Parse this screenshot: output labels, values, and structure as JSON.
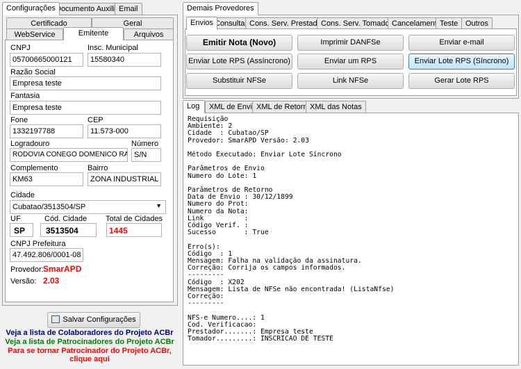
{
  "left": {
    "top_tabs": [
      "Configurações",
      "Documento Auxiliar",
      "Email"
    ],
    "row1_tabs": [
      "Certificado",
      "Geral"
    ],
    "row2_tabs": [
      "WebService",
      "Emitente",
      "Arquivos"
    ],
    "emitente": {
      "cnpj_label": "CNPJ",
      "cnpj": "05700665000121",
      "im_label": "Insc. Municipal",
      "im": "15580340",
      "razao_label": "Razão Social",
      "razao": "Empresa teste",
      "fantasia_label": "Fantasia",
      "fantasia": "Empresa teste",
      "fone_label": "Fone",
      "fone": "1332197788",
      "cep_label": "CEP",
      "cep": "11.573-000",
      "logradouro_label": "Logradouro",
      "logradouro": "RODOVIA CONEGO DOMENICO RANGO",
      "numero_label": "Número",
      "numero": "S/N",
      "complemento_label": "Complemento",
      "complemento": "KM63",
      "bairro_label": "Bairro",
      "bairro": "ZONA INDUSTRIAL",
      "cidade_label": "Cidade",
      "cidade": "Cubatao/3513504/SP",
      "uf_label": "UF",
      "uf": "SP",
      "cod_cidade_label": "Cód. Cidade",
      "cod_cidade": "3513504",
      "total_cidades_label": "Total de Cidades",
      "total_cidades": "1445",
      "cnpj_pref_label": "CNPJ Prefeitura",
      "cnpj_pref": "47.492.806/0001-08",
      "provedor_label": "Provedor:",
      "provedor": "SmarAPD",
      "versao_label": "Versão:",
      "versao": "2.03"
    },
    "save_button": "Salvar Configurações",
    "link_colaboradores": "Veja a lista de Colaboradores do Projeto ACBr",
    "link_patrocinadores": "Veja a lista de Patrocinadores do Projeto ACBr",
    "link_patrocinador_1": "Para se tornar Patrocinador do Projeto ACBr,",
    "link_patrocinador_2": "clique aqui"
  },
  "right": {
    "top_tab": "Demais Provedores",
    "tabs": [
      "Envios",
      "Consultas",
      "Cons. Serv. Prestados",
      "Cons. Serv. Tomados",
      "Cancelamento",
      "Teste",
      "Outros"
    ],
    "buttons": {
      "emitir": "Emitir Nota (Novo)",
      "imprimir": "Imprimir DANFSe",
      "email": "Enviar e-mail",
      "lote_assinc": "Enviar Lote RPS (Assíncrono)",
      "um_rps": "Enviar um RPS",
      "lote_sinc": "Enviar Lote RPS (Síncrono)",
      "substituir": "Substituir NFSe",
      "link": "Link NFSe",
      "gerar": "Gerar Lote RPS"
    },
    "log_tabs": [
      "Log",
      "XML de Envio",
      "XML de Retorno",
      "XML das Notas"
    ],
    "log_text": "Requisição\nAmbiente: 2\nCidade  : Cubatao/SP\nProvedor: SmarAPD Versão: 2.03\n\nMétodo Executado: Enviar Lote Síncrono\n\nParâmetros de Envio\nNumero do Lote: 1\n\nParâmetros de Retorno\nData de Envio : 30/12/1899\nNumero do Prot:\nNumero da Nota:\nLink          :\nCódigo Verif. :\nSucesso       : True\n\nErro(s):\nCódigo  : 1\nMensagem: Falha na validação da assinatura.\nCorreção: Corrija os campos informados.\n---------\nCódigo  : X202\nMensagem: Lista de NFSe não encontrada! (ListaNfse)\nCorreção:\n---------\n\nNFS-e Numero....: 1\nCod. Verificacao:\nPrestador.......: Empresa teste\nTomador.........: INSCRICAO DE TESTE"
  },
  "colors": {
    "red": "#ff0000",
    "blue": "#000080",
    "green": "#008000",
    "focus": "#3c7fb1"
  }
}
